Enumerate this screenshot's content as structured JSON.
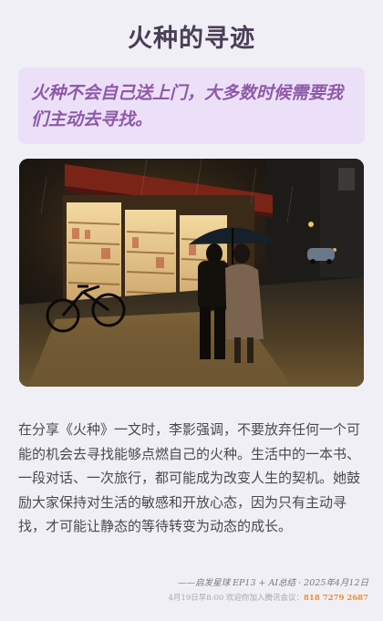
{
  "article": {
    "title": "火种的寻迹",
    "quote": "火种不会自己送上门，大多数时候需要我们主动去寻找。",
    "body": "在分享《火种》一文时，李影强调，不要放弃任何一个可能的机会去寻找能够点燃自己的火种。生活中的一本书、一段对话、一次旅行，都可能成为改变人生的契机。她鼓励大家保持对生活的敏感和开放心态，因为只有主动寻找，才可能让静态的等待转变为动态的成长。"
  },
  "footer": {
    "signature": "——启发星球 EP13 + AI总结 · 2025年4月12日",
    "notice_prefix": "4月19日早8:00 欢迎你加入腾讯会议：",
    "meeting_id": "818 7279 2687"
  },
  "colors": {
    "background": "#f1eff6",
    "title": "#4a3f57",
    "quote_bg": "#ece0f8",
    "quote_text": "#8e5aa8",
    "accent_orange": "#e8902e"
  }
}
